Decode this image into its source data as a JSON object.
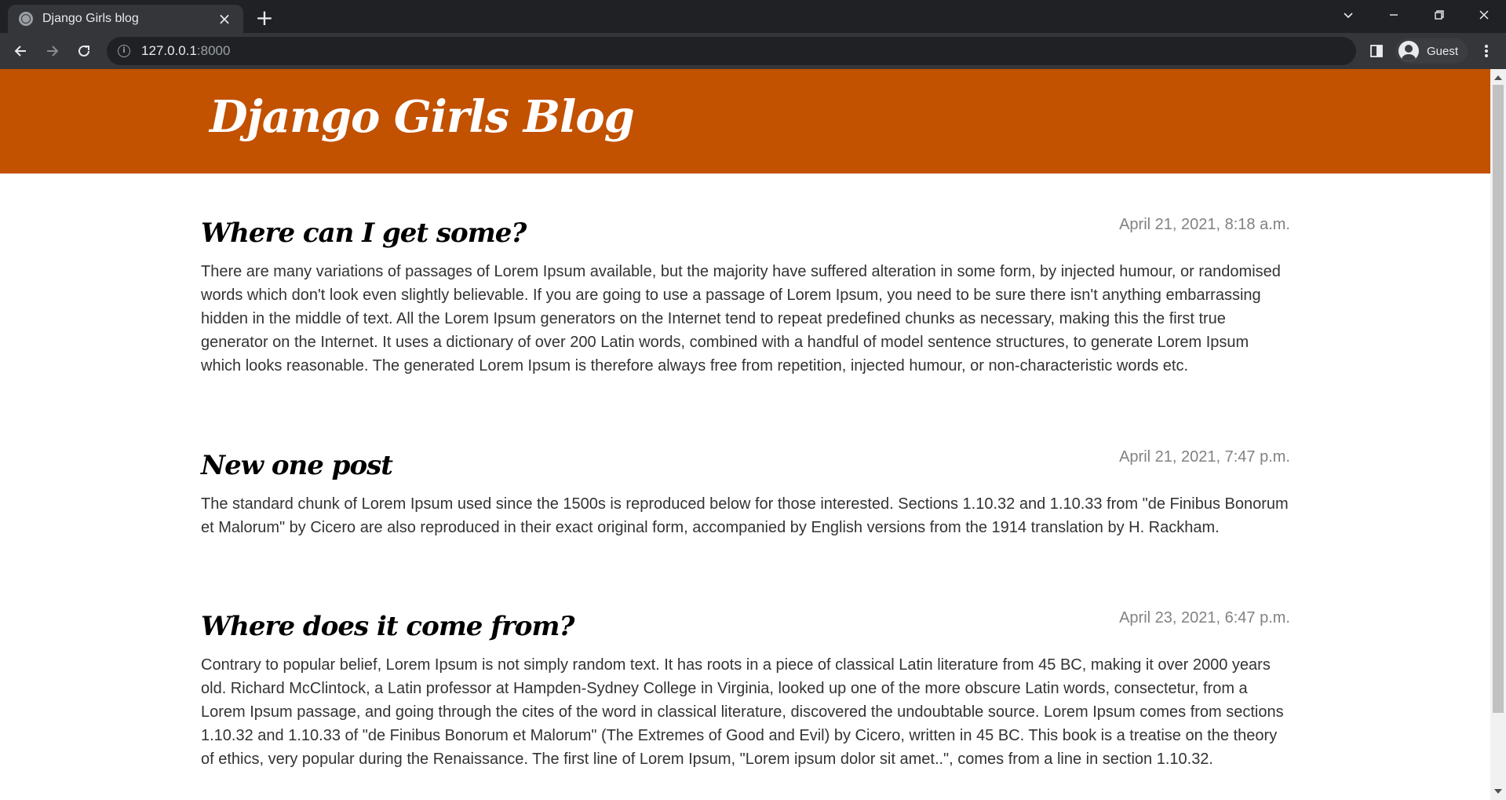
{
  "browser": {
    "tab_title": "Django Girls blog",
    "address_host": "127.0.0.1",
    "address_port": ":8000",
    "profile_label": "Guest"
  },
  "page": {
    "header_title": "Django Girls Blog",
    "brand_color": "#c25100"
  },
  "posts": [
    {
      "title": "Where can I get some?",
      "date": "April 21, 2021, 8:18 a.m.",
      "body": "There are many variations of passages of Lorem Ipsum available, but the majority have suffered alteration in some form, by injected humour, or randomised words which don't look even slightly believable. If you are going to use a passage of Lorem Ipsum, you need to be sure there isn't anything embarrassing hidden in the middle of text. All the Lorem Ipsum generators on the Internet tend to repeat predefined chunks as necessary, making this the first true generator on the Internet. It uses a dictionary of over 200 Latin words, combined with a handful of model sentence structures, to generate Lorem Ipsum which looks reasonable. The generated Lorem Ipsum is therefore always free from repetition, injected humour, or non-characteristic words etc."
    },
    {
      "title": "New one post",
      "date": "April 21, 2021, 7:47 p.m.",
      "body": "The standard chunk of Lorem Ipsum used since the 1500s is reproduced below for those interested. Sections 1.10.32 and 1.10.33 from \"de Finibus Bonorum et Malorum\" by Cicero are also reproduced in their exact original form, accompanied by English versions from the 1914 translation by H. Rackham."
    },
    {
      "title": "Where does it come from?",
      "date": "April 23, 2021, 6:47 p.m.",
      "body": "Contrary to popular belief, Lorem Ipsum is not simply random text. It has roots in a piece of classical Latin literature from 45 BC, making it over 2000 years old. Richard McClintock, a Latin professor at Hampden-Sydney College in Virginia, looked up one of the more obscure Latin words, consectetur, from a Lorem Ipsum passage, and going through the cites of the word in classical literature, discovered the undoubtable source. Lorem Ipsum comes from sections 1.10.32 and 1.10.33 of \"de Finibus Bonorum et Malorum\" (The Extremes of Good and Evil) by Cicero, written in 45 BC. This book is a treatise on the theory of ethics, very popular during the Renaissance. The first line of Lorem Ipsum, \"Lorem ipsum dolor sit amet..\", comes from a line in section 1.10.32."
    }
  ]
}
